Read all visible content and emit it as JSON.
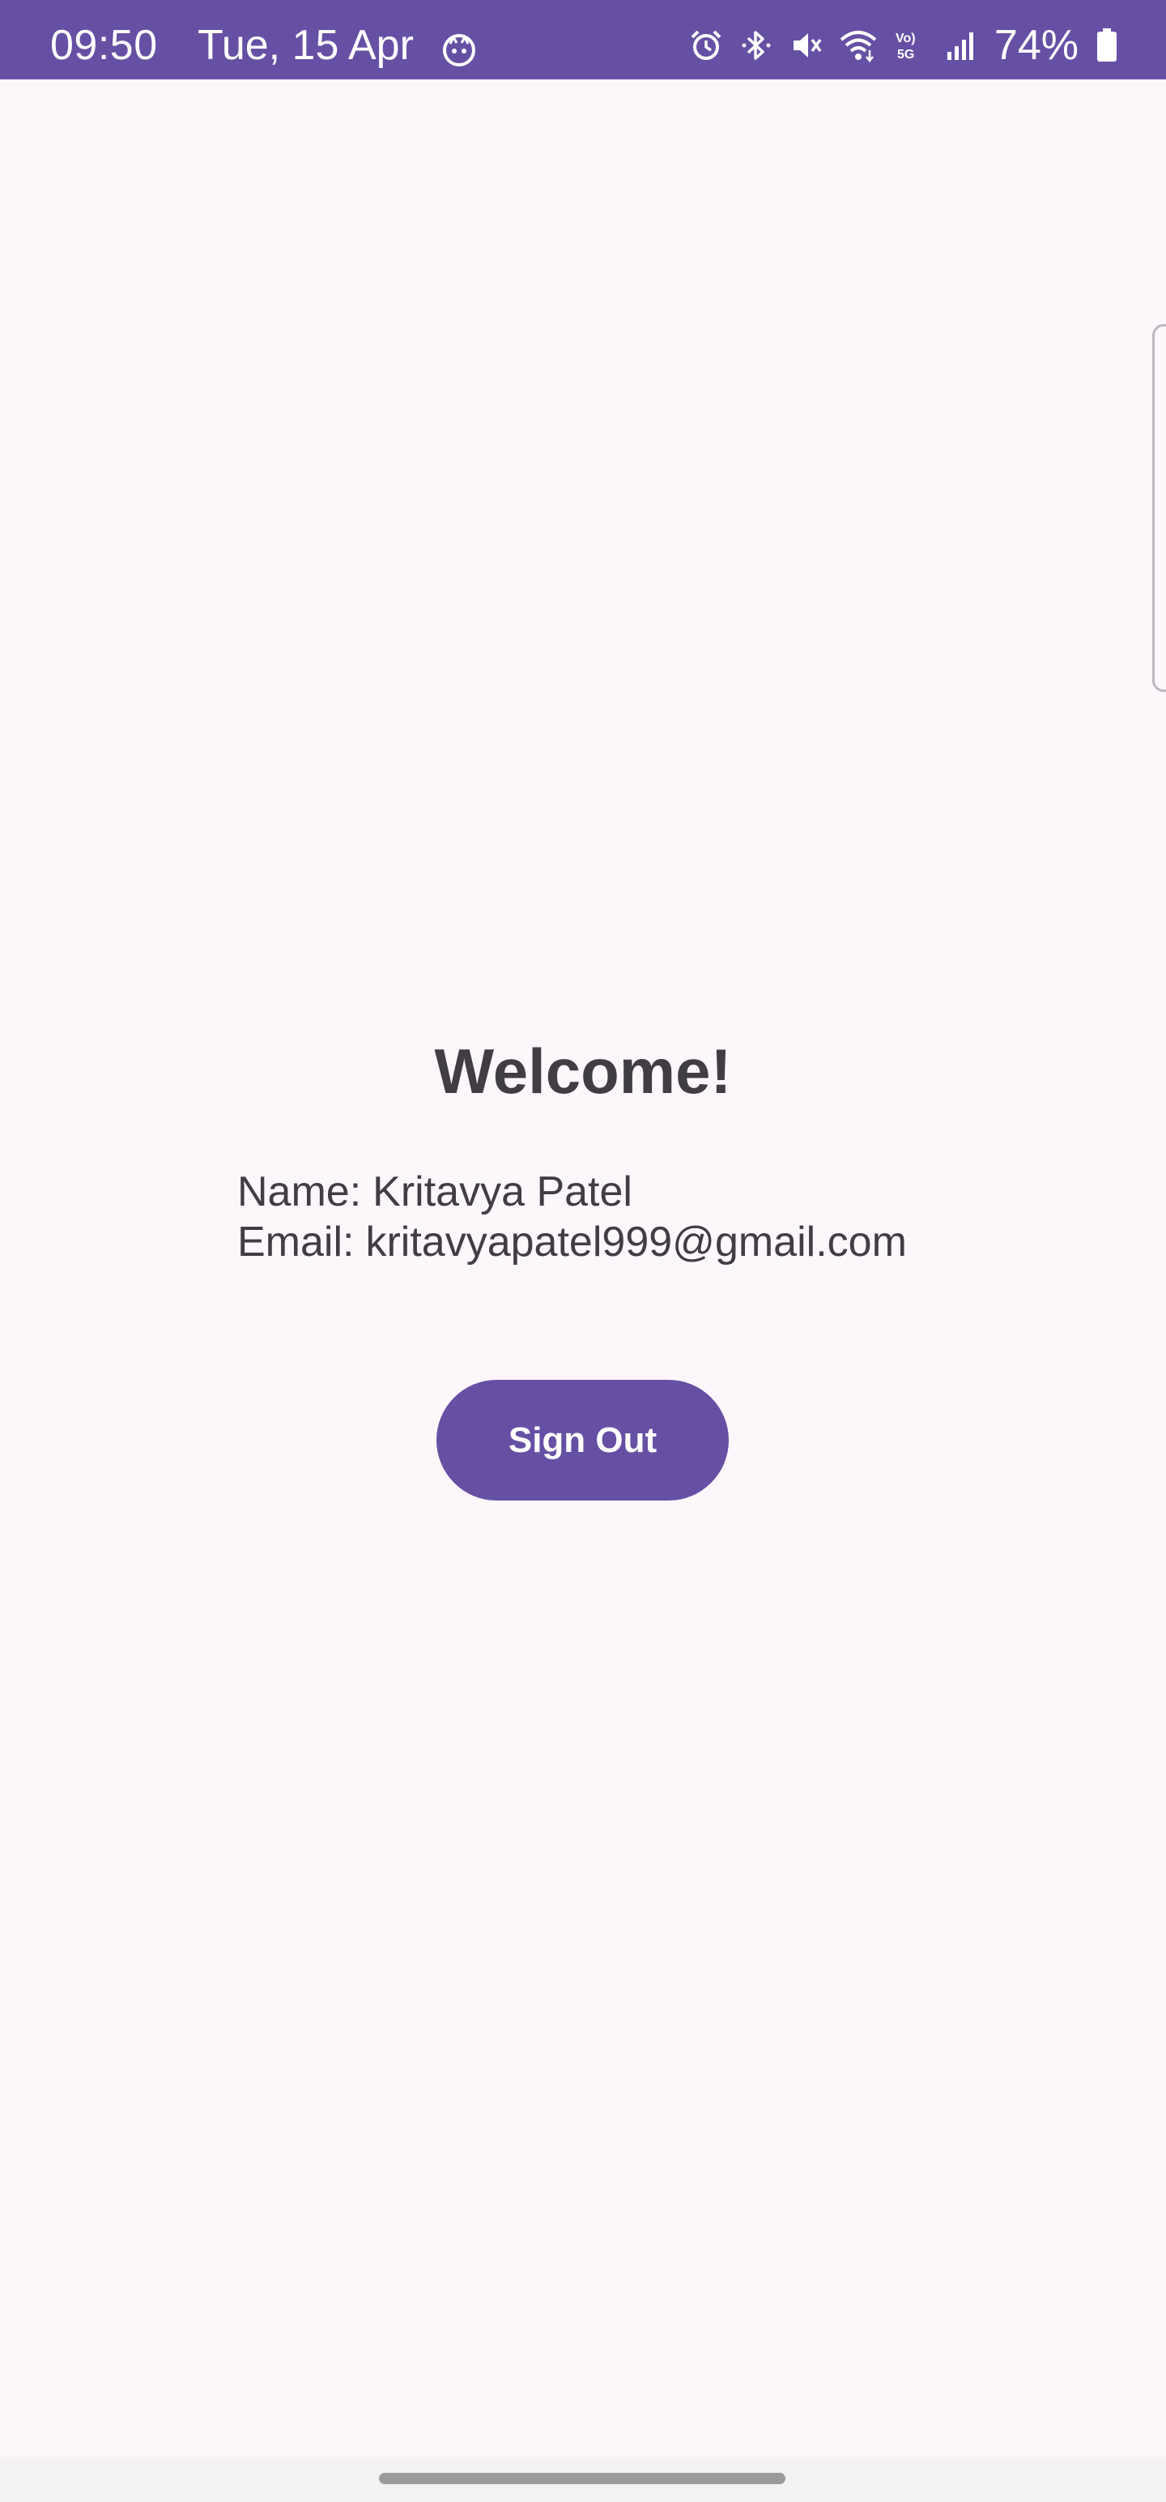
{
  "status_bar": {
    "time": "09:50",
    "date": "Tue, 15 Apr",
    "battery_percent": "74%",
    "background_color": "#6650a4",
    "icons": [
      "app-notification-icon",
      "alarm-icon",
      "bluetooth-icon",
      "mute-icon",
      "wifi-icon",
      "volte-5g-icon",
      "signal-icon",
      "battery-icon"
    ]
  },
  "main": {
    "title": "Welcome!",
    "name_label": "Name:",
    "name_value": "Kritavya Patel",
    "email_label": "Email:",
    "email_value": "kritavyapatel999@gmail.com",
    "sign_out_label": "Sign Out"
  },
  "theme": {
    "accent": "#6650a4",
    "background": "#fdf7fc",
    "text": "#413d45"
  }
}
